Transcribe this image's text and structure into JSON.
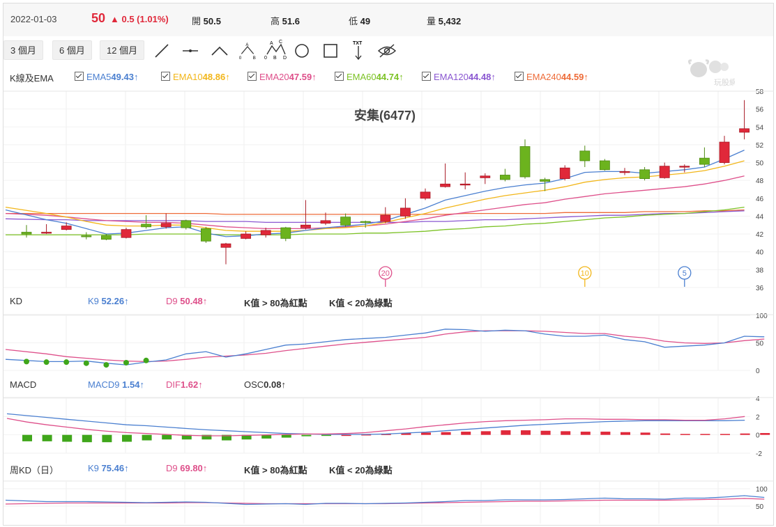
{
  "quote": {
    "date": "2022-01-03",
    "price": "50",
    "change_arrow": "▲",
    "change": "0.5 (1.01%)",
    "open_label": "開",
    "open": "50.5",
    "high_label": "高",
    "high": "51.6",
    "low_label": "低",
    "low": "49",
    "volume_label": "量",
    "volume": "5,432",
    "up_color": "#e0283a"
  },
  "toolbar": {
    "ranges": [
      "3 個月",
      "6 個月",
      "12 個月"
    ],
    "tools": [
      "line-tool-icon",
      "horizontal-line-tool-icon",
      "angle-tool-icon",
      "abc-pattern-tool-icon",
      "abcd-pattern-tool-icon",
      "circle-tool-icon",
      "rectangle-tool-icon",
      "text-tool-icon",
      "hide-eye-icon"
    ],
    "text_tool_label": "TXT",
    "abc_labels": [
      "0",
      "A",
      "B"
    ],
    "abcd_labels": [
      "0",
      "A",
      "B",
      "C",
      "D"
    ]
  },
  "watermark": {
    "text": "玩股網"
  },
  "main_legend": {
    "title": "K線及EMA",
    "items": [
      {
        "name": "EMA5",
        "value": "49.43",
        "arrow": "↑",
        "color": "#4a7fd0"
      },
      {
        "name": "EMA10",
        "value": "48.86",
        "arrow": "↑",
        "color": "#f2b619"
      },
      {
        "name": "EMA20",
        "value": "47.59",
        "arrow": "↑",
        "color": "#de4f8a"
      },
      {
        "name": "EMA60",
        "value": "44.74",
        "arrow": "↑",
        "color": "#7cc225"
      },
      {
        "name": "EMA120",
        "value": "44.48",
        "arrow": "↑",
        "color": "#8a57d1"
      },
      {
        "name": "EMA240",
        "value": "44.59",
        "arrow": "↑",
        "color": "#ee6b38"
      }
    ]
  },
  "kd_legend": {
    "title": "KD",
    "k_name": "K9",
    "k_value": "52.26",
    "k_arrow": "↑",
    "d_name": "D9",
    "d_value": "50.48",
    "d_arrow": "↑",
    "note1": "K值 > 80為紅點",
    "note2": "K值 < 20為綠點"
  },
  "macd_legend": {
    "title": "MACD",
    "macd_name": "MACD9",
    "macd_value": "1.54",
    "macd_arrow": "↑",
    "dif_name": "DIF",
    "dif_value": "1.62",
    "dif_arrow": "↑",
    "osc_name": "OSC",
    "osc_value": "0.08",
    "osc_arrow": "↑"
  },
  "wkd_legend": {
    "title": "周KD（日）",
    "k_name": "K9",
    "k_value": "75.46",
    "k_arrow": "↑",
    "d_name": "D9",
    "d_value": "69.80",
    "d_arrow": "↑",
    "note1": "K值 > 80為紅點",
    "note2": "K值 < 20為綠點"
  },
  "chart_data": [
    {
      "type": "candlestick",
      "title": "安集(6477)",
      "ylim": [
        36,
        58
      ],
      "yticks": [
        36,
        38,
        40,
        42,
        44,
        46,
        48,
        50,
        52,
        54,
        56,
        58
      ],
      "candles": [
        {
          "o": 42.2,
          "c": 42.0,
          "h": 43.0,
          "l": 41.6
        },
        {
          "o": 42.2,
          "c": 42.2,
          "h": 43.1,
          "l": 42.0
        },
        {
          "o": 42.5,
          "c": 42.9,
          "h": 43.3,
          "l": 42.4
        },
        {
          "o": 41.8,
          "c": 41.7,
          "h": 42.2,
          "l": 41.4
        },
        {
          "o": 41.8,
          "c": 41.4,
          "h": 42.0,
          "l": 41.3
        },
        {
          "o": 41.6,
          "c": 42.5,
          "h": 42.7,
          "l": 41.5
        },
        {
          "o": 43.1,
          "c": 42.8,
          "h": 44.1,
          "l": 42.6
        },
        {
          "o": 42.8,
          "c": 43.2,
          "h": 44.3,
          "l": 42.6
        },
        {
          "o": 43.5,
          "c": 42.7,
          "h": 43.6,
          "l": 42.5
        },
        {
          "o": 42.6,
          "c": 41.2,
          "h": 42.8,
          "l": 41.0
        },
        {
          "o": 40.5,
          "c": 40.9,
          "h": 41.0,
          "l": 38.6
        },
        {
          "o": 41.5,
          "c": 42.0,
          "h": 42.3,
          "l": 41.4
        },
        {
          "o": 41.9,
          "c": 42.4,
          "h": 42.7,
          "l": 41.6
        },
        {
          "o": 42.7,
          "c": 41.5,
          "h": 42.8,
          "l": 41.2
        },
        {
          "o": 42.7,
          "c": 43.0,
          "h": 45.8,
          "l": 42.5
        },
        {
          "o": 43.2,
          "c": 43.5,
          "h": 44.4,
          "l": 43.0
        },
        {
          "o": 43.9,
          "c": 43.0,
          "h": 44.3,
          "l": 42.8
        },
        {
          "o": 43.4,
          "c": 43.3,
          "h": 43.5,
          "l": 42.7
        },
        {
          "o": 43.4,
          "c": 44.1,
          "h": 45.0,
          "l": 43.2
        },
        {
          "o": 44.0,
          "c": 44.9,
          "h": 46.0,
          "l": 43.7
        },
        {
          "o": 46.0,
          "c": 46.7,
          "h": 47.1,
          "l": 45.8
        },
        {
          "o": 47.3,
          "c": 47.6,
          "h": 49.9,
          "l": 47.2
        },
        {
          "o": 47.6,
          "c": 47.6,
          "h": 48.9,
          "l": 47.0
        },
        {
          "o": 48.3,
          "c": 48.5,
          "h": 48.8,
          "l": 47.6
        },
        {
          "o": 48.6,
          "c": 48.1,
          "h": 49.3,
          "l": 47.9
        },
        {
          "o": 51.8,
          "c": 48.4,
          "h": 52.6,
          "l": 48.2
        },
        {
          "o": 48.1,
          "c": 47.9,
          "h": 48.3,
          "l": 46.8
        },
        {
          "o": 48.2,
          "c": 49.4,
          "h": 49.7,
          "l": 48.0
        },
        {
          "o": 51.3,
          "c": 50.2,
          "h": 51.9,
          "l": 49.5
        },
        {
          "o": 50.2,
          "c": 49.2,
          "h": 50.4,
          "l": 49.1
        },
        {
          "o": 48.9,
          "c": 49.0,
          "h": 49.4,
          "l": 48.6
        },
        {
          "o": 49.2,
          "c": 48.2,
          "h": 49.5,
          "l": 48.0
        },
        {
          "o": 48.3,
          "c": 49.6,
          "h": 50.0,
          "l": 48.2
        },
        {
          "o": 49.5,
          "c": 49.6,
          "h": 49.8,
          "l": 48.9
        },
        {
          "o": 50.5,
          "c": 49.8,
          "h": 51.7,
          "l": 49.5
        },
        {
          "o": 50.0,
          "c": 52.3,
          "h": 53.0,
          "l": 49.8
        },
        {
          "o": 53.4,
          "c": 53.8,
          "h": 57.0,
          "l": 52.6
        }
      ],
      "ema": {
        "EMA5": [
          44.7,
          43.6,
          43.2,
          42.6,
          42.0,
          42.1,
          42.4,
          42.7,
          42.8,
          42.1,
          41.7,
          41.8,
          42.0,
          42.1,
          42.4,
          42.7,
          42.9,
          43.1,
          43.5,
          44.2,
          44.9,
          45.8,
          46.3,
          46.8,
          47.2,
          47.5,
          47.7,
          48.2,
          48.9,
          49.0,
          49.0,
          48.8,
          49.0,
          49.2,
          49.5,
          50.4,
          51.4
        ],
        "EMA10": [
          45.0,
          44.3,
          43.9,
          43.4,
          43.0,
          42.9,
          42.9,
          43.0,
          43.0,
          42.7,
          42.4,
          42.3,
          42.3,
          42.3,
          42.4,
          42.6,
          42.7,
          42.9,
          43.3,
          43.8,
          44.3,
          44.9,
          45.4,
          45.9,
          46.3,
          46.6,
          46.9,
          47.3,
          47.8,
          48.1,
          48.3,
          48.4,
          48.6,
          48.8,
          49.1,
          49.6,
          50.2
        ],
        "EMA20": [
          44.3,
          44.1,
          43.9,
          43.7,
          43.5,
          43.4,
          43.3,
          43.3,
          43.2,
          43.0,
          42.8,
          42.7,
          42.6,
          42.6,
          42.6,
          42.7,
          42.8,
          42.9,
          43.1,
          43.4,
          43.7,
          44.1,
          44.4,
          44.7,
          45.0,
          45.3,
          45.5,
          45.9,
          46.2,
          46.5,
          46.7,
          46.9,
          47.1,
          47.3,
          47.6,
          48.0,
          48.5
        ],
        "EMA60": [
          41.9,
          41.9,
          41.9,
          41.9,
          41.9,
          41.9,
          42.0,
          42.0,
          42.0,
          42.0,
          41.9,
          41.9,
          41.9,
          41.9,
          42.0,
          42.0,
          42.0,
          42.1,
          42.1,
          42.2,
          42.3,
          42.5,
          42.6,
          42.8,
          42.9,
          43.1,
          43.2,
          43.4,
          43.6,
          43.8,
          43.9,
          44.1,
          44.2,
          44.3,
          44.5,
          44.7,
          45.0
        ],
        "EMA120": [
          43.7,
          43.6,
          43.6,
          43.5,
          43.5,
          43.5,
          43.5,
          43.5,
          43.5,
          43.4,
          43.4,
          43.4,
          43.3,
          43.3,
          43.3,
          43.3,
          43.3,
          43.3,
          43.3,
          43.3,
          43.4,
          43.4,
          43.5,
          43.6,
          43.6,
          43.7,
          43.8,
          43.9,
          44.0,
          44.1,
          44.1,
          44.2,
          44.3,
          44.3,
          44.4,
          44.5,
          44.6
        ],
        "EMA240": [
          44.3,
          44.3,
          44.3,
          44.3,
          44.3,
          44.3,
          44.3,
          44.3,
          44.3,
          44.3,
          44.2,
          44.2,
          44.2,
          44.2,
          44.2,
          44.2,
          44.2,
          44.2,
          44.2,
          44.2,
          44.2,
          44.2,
          44.3,
          44.3,
          44.3,
          44.3,
          44.3,
          44.4,
          44.4,
          44.4,
          44.4,
          44.5,
          44.5,
          44.5,
          44.6,
          44.6,
          44.7
        ]
      },
      "markers": [
        {
          "label": "20",
          "index": 18,
          "color": "#de4f8a"
        },
        {
          "label": "10",
          "index": 28,
          "color": "#f2b619"
        },
        {
          "label": "5",
          "index": 33,
          "color": "#4a7fd0"
        }
      ]
    },
    {
      "type": "line",
      "title": "KD",
      "ylim": [
        0,
        100
      ],
      "yticks": [
        0,
        50,
        100
      ],
      "series": [
        {
          "name": "K9",
          "color": "#4a7fd0",
          "values": [
            20,
            16,
            16,
            17,
            13,
            10,
            15,
            19,
            30,
            34,
            24,
            30,
            38,
            46,
            48,
            52,
            56,
            58,
            60,
            64,
            68,
            75,
            74,
            71,
            73,
            72,
            66,
            62,
            62,
            64,
            56,
            52,
            42,
            44,
            46,
            50,
            62,
            61
          ]
        },
        {
          "name": "D9",
          "color": "#de4f8a",
          "values": [
            38,
            30,
            25,
            22,
            19,
            17,
            16,
            17,
            20,
            24,
            26,
            28,
            31,
            36,
            40,
            44,
            48,
            51,
            54,
            57,
            60,
            66,
            70,
            72,
            72,
            72,
            71,
            69,
            67,
            67,
            62,
            59,
            53,
            50,
            49,
            50,
            54,
            57
          ]
        }
      ],
      "dots": [
        {
          "index": 1,
          "value": 16,
          "color": "#3fa61a"
        },
        {
          "index": 2,
          "value": 15,
          "color": "#3fa61a"
        },
        {
          "index": 3,
          "value": 15,
          "color": "#3fa61a"
        },
        {
          "index": 4,
          "value": 13,
          "color": "#3fa61a"
        },
        {
          "index": 5,
          "value": 10,
          "color": "#3fa61a"
        },
        {
          "index": 6,
          "value": 14,
          "color": "#3fa61a"
        },
        {
          "index": 7,
          "value": 18,
          "color": "#3fa61a"
        }
      ]
    },
    {
      "type": "bar+line",
      "title": "MACD",
      "ylim": [
        -2,
        4
      ],
      "yticks": [
        -2,
        0,
        2,
        4
      ],
      "osc": [
        -0.7,
        -0.7,
        -0.75,
        -0.8,
        -0.8,
        -0.75,
        -0.6,
        -0.5,
        -0.5,
        -0.5,
        -0.6,
        -0.5,
        -0.4,
        -0.3,
        -0.15,
        -0.05,
        0,
        0.05,
        0.1,
        0.2,
        0.25,
        0.3,
        0.35,
        0.4,
        0.5,
        0.5,
        0.45,
        0.4,
        0.35,
        0.35,
        0.3,
        0.25,
        0.15,
        0.1,
        0.1,
        0.1,
        0.15,
        0.2
      ],
      "series": [
        {
          "name": "MACD9",
          "color": "#4a7fd0",
          "values": [
            2.3,
            2.1,
            1.9,
            1.7,
            1.5,
            1.3,
            1.1,
            1.0,
            0.85,
            0.7,
            0.55,
            0.45,
            0.35,
            0.25,
            0.15,
            0.1,
            0.05,
            0.05,
            0.05,
            0.1,
            0.2,
            0.3,
            0.45,
            0.6,
            0.75,
            0.9,
            1.05,
            1.15,
            1.25,
            1.35,
            1.45,
            1.5,
            1.55,
            1.55,
            1.55,
            1.55,
            1.55,
            1.6
          ]
        },
        {
          "name": "DIF",
          "color": "#de4f8a",
          "values": [
            1.8,
            1.4,
            1.1,
            0.85,
            0.6,
            0.4,
            0.25,
            0.15,
            0.05,
            -0.05,
            -0.1,
            -0.1,
            -0.05,
            0.0,
            0.05,
            0.1,
            0.1,
            0.15,
            0.25,
            0.45,
            0.65,
            0.9,
            1.1,
            1.3,
            1.45,
            1.55,
            1.6,
            1.65,
            1.75,
            1.75,
            1.7,
            1.7,
            1.65,
            1.65,
            1.6,
            1.6,
            1.75,
            2.0
          ]
        }
      ]
    },
    {
      "type": "line",
      "title": "周KD（日）",
      "ylim": [
        0,
        120
      ],
      "yticks": [
        50,
        100
      ],
      "series": [
        {
          "name": "K9",
          "color": "#4a7fd0",
          "values": [
            67,
            63,
            63,
            63,
            62,
            61,
            60,
            61,
            62,
            61,
            58,
            55,
            56,
            57,
            55,
            58,
            58,
            57,
            58,
            59,
            61,
            63,
            66,
            66,
            68,
            68,
            68,
            69,
            71,
            73,
            71,
            71,
            70,
            73,
            73,
            76,
            80,
            75
          ]
        },
        {
          "name": "D9",
          "color": "#de4f8a",
          "values": [
            56,
            58,
            59,
            59,
            59,
            59,
            59,
            59,
            60,
            60,
            59,
            58,
            57,
            57,
            57,
            57,
            57,
            57,
            57,
            58,
            59,
            60,
            61,
            62,
            63,
            64,
            64,
            65,
            66,
            67,
            67,
            67,
            67,
            68,
            69,
            70,
            72,
            70
          ]
        }
      ]
    }
  ]
}
